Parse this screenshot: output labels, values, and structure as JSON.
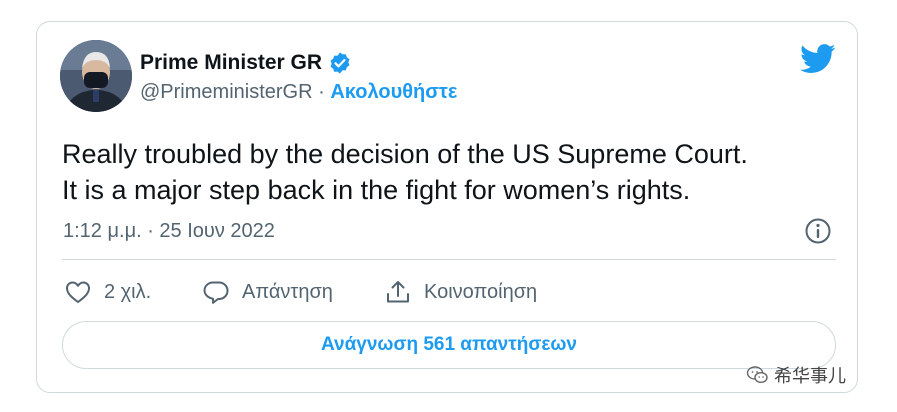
{
  "author": {
    "display_name": "Prime Minister GR",
    "handle": "@PrimeministerGR",
    "separator": " · ",
    "follow_label": "Ακολουθήστε"
  },
  "tweet": {
    "lines": [
      "Really troubled by the decision of the US Supreme Court.",
      "It is a major step back in the fight for women’s rights."
    ],
    "timestamp": "1:12 μ.μ. · 25 Ιουν 2022"
  },
  "actions": {
    "like_count": "2 χιλ.",
    "reply_label": "Απάντηση",
    "share_label": "Κοινοποίηση"
  },
  "replies_button_label": "Ανάγνωση 561 απαντήσεων",
  "watermark_text": "希华事儿",
  "icons": {
    "verified": "verified-badge-icon",
    "twitter": "twitter-bird-icon",
    "info": "info-icon",
    "like": "heart-icon",
    "reply": "speech-bubble-icon",
    "share": "share-upload-icon"
  },
  "colors": {
    "accent": "#1d9bf0",
    "text": "#0f1419",
    "secondary": "#536471",
    "border": "#cfd9de"
  }
}
